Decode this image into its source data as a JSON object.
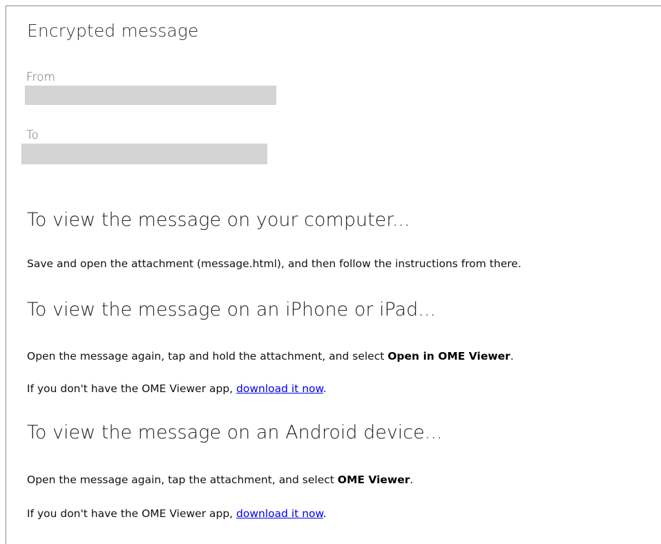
{
  "title": "Encrypted message",
  "from": {
    "label": "From",
    "value_redacted": true
  },
  "to": {
    "label": "To",
    "value_redacted": true
  },
  "sections": {
    "computer": {
      "heading": "To view the message on your computer...",
      "text": "Save and open the attachment (message.html), and then follow the instructions from there."
    },
    "iphone": {
      "heading": "To view the message on an iPhone or iPad...",
      "text_before": "Open the message again, tap and hold the attachment, and select ",
      "bold": "Open in OME Viewer",
      "text_after": ".",
      "download_prefix": "If you don't have the OME Viewer app, ",
      "download_link": "download it now",
      "download_suffix": "."
    },
    "android": {
      "heading": "To view the message on an Android device...",
      "text_before": "Open the message again, tap the attachment, and select ",
      "bold": "OME Viewer",
      "text_after": ".",
      "download_prefix": "If you don't have the OME Viewer app, ",
      "download_link": "download it now",
      "download_suffix": "."
    }
  },
  "colors": {
    "link": "#0000ee",
    "redaction": "#d4d4d4"
  }
}
